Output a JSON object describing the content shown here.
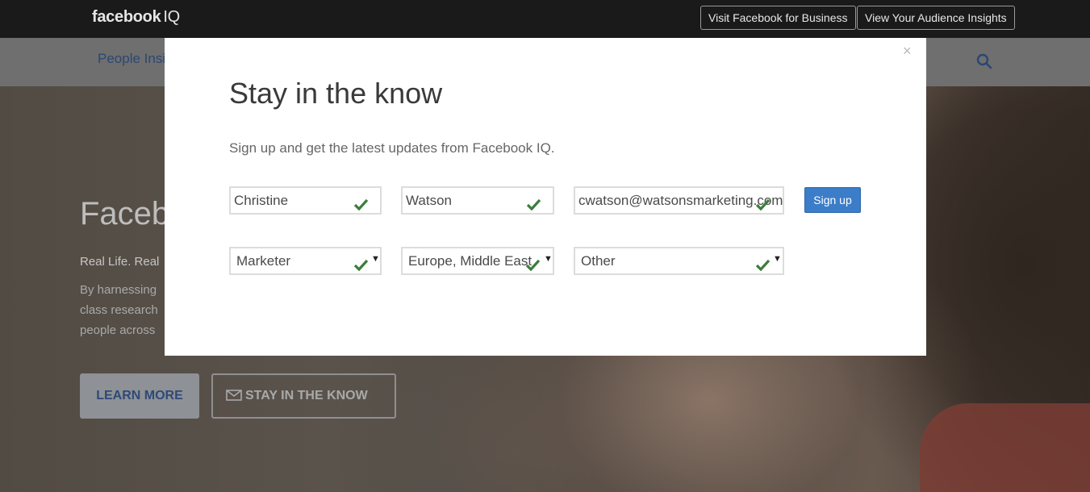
{
  "header": {
    "logo_main": "facebook",
    "logo_suffix": "IQ",
    "visit_business_label": "Visit Facebook for Business",
    "audience_insights_label": "View Your Audience Insights"
  },
  "subnav": {
    "visible_link": "People Insi",
    "search_icon": "search-icon"
  },
  "hero": {
    "title": "Faceb",
    "tagline": "Real Life. Real",
    "body_lines": [
      "By harnessing",
      "class research",
      "people across"
    ],
    "learn_more_label": "LEARN MORE",
    "stay_label": "STAY IN THE KNOW"
  },
  "modal": {
    "close_label": "×",
    "title": "Stay in the know",
    "subtitle": "Sign up and get the latest updates from Facebook IQ.",
    "fields": {
      "first_name": "Christine",
      "last_name": "Watson",
      "email": "cwatson@watsonsmarketing.com",
      "role": "Marketer",
      "region": "Europe, Middle East",
      "other": "Other"
    },
    "signup_label": "Sign up"
  },
  "colors": {
    "valid_check": "#3a7d3a",
    "signup_bg": "#3b7dc8",
    "topbar_bg": "#1a1a1a"
  }
}
